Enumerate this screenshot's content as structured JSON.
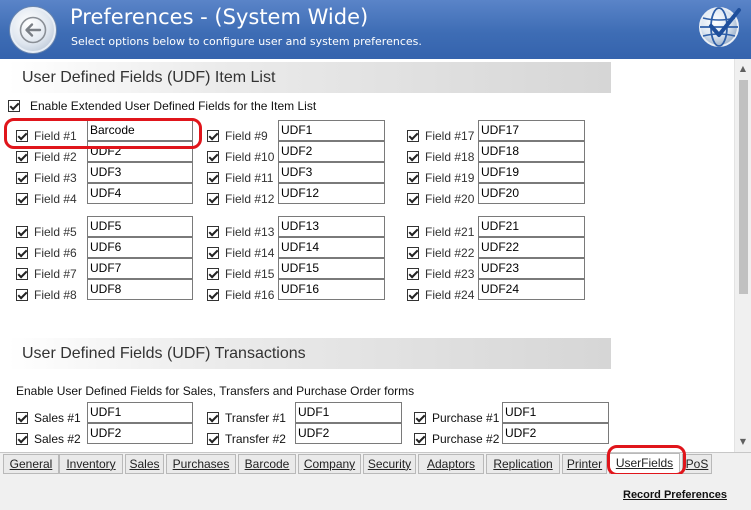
{
  "header": {
    "title": "Preferences - (System Wide)",
    "subtitle": "Select options below to configure user and system preferences."
  },
  "udf_items": {
    "section_title": "User Defined Fields (UDF) Item List",
    "enable_label": "Enable Extended User Defined Fields for the Item List",
    "enable_checked": true,
    "fields": [
      {
        "label": "Field #1",
        "value": "Barcode",
        "checked": true
      },
      {
        "label": "Field #2",
        "value": "UDF2",
        "checked": true
      },
      {
        "label": "Field #3",
        "value": "UDF3",
        "checked": true
      },
      {
        "label": "Field #4",
        "value": "UDF4",
        "checked": true
      },
      {
        "label": "Field #5",
        "value": "UDF5",
        "checked": true
      },
      {
        "label": "Field #6",
        "value": "UDF6",
        "checked": true
      },
      {
        "label": "Field #7",
        "value": "UDF7",
        "checked": true
      },
      {
        "label": "Field #8",
        "value": "UDF8",
        "checked": true
      },
      {
        "label": "Field #9",
        "value": "UDF1",
        "checked": true
      },
      {
        "label": "Field #10",
        "value": "UDF2",
        "checked": true
      },
      {
        "label": "Field #11",
        "value": "UDF3",
        "checked": true
      },
      {
        "label": "Field #12",
        "value": "UDF12",
        "checked": true
      },
      {
        "label": "Field #13",
        "value": "UDF13",
        "checked": true
      },
      {
        "label": "Field #14",
        "value": "UDF14",
        "checked": true
      },
      {
        "label": "Field #15",
        "value": "UDF15",
        "checked": true
      },
      {
        "label": "Field #16",
        "value": "UDF16",
        "checked": true
      },
      {
        "label": "Field #17",
        "value": "UDF17",
        "checked": true
      },
      {
        "label": "Field #18",
        "value": "UDF18",
        "checked": true
      },
      {
        "label": "Field #19",
        "value": "UDF19",
        "checked": true
      },
      {
        "label": "Field #20",
        "value": "UDF20",
        "checked": true
      },
      {
        "label": "Field #21",
        "value": "UDF21",
        "checked": true
      },
      {
        "label": "Field #22",
        "value": "UDF22",
        "checked": true
      },
      {
        "label": "Field #23",
        "value": "UDF23",
        "checked": true
      },
      {
        "label": "Field #24",
        "value": "UDF24",
        "checked": true
      }
    ]
  },
  "udf_transactions": {
    "section_title": "User Defined Fields (UDF) Transactions",
    "description": "Enable User Defined Fields for Sales, Transfers and Purchase Order forms",
    "sales": [
      {
        "label": "Sales #1",
        "value": "UDF1",
        "checked": true
      },
      {
        "label": "Sales #2",
        "value": "UDF2",
        "checked": true
      }
    ],
    "transfer": [
      {
        "label": "Transfer #1",
        "value": "UDF1",
        "checked": true
      },
      {
        "label": "Transfer #2",
        "value": "UDF2",
        "checked": true
      }
    ],
    "purchase": [
      {
        "label": "Purchase #1",
        "value": "UDF1",
        "checked": true
      },
      {
        "label": "Purchase #2",
        "value": "UDF2",
        "checked": true
      }
    ]
  },
  "tabs": [
    "General",
    "Inventory",
    "Sales",
    "Purchases",
    "Barcode",
    "Company",
    "Security",
    "Adaptors",
    "Replication",
    "Printer",
    "UserFields",
    "PoS"
  ],
  "active_tab": "UserFields",
  "footer": {
    "record_label": "Record Preferences"
  },
  "colors": {
    "header": "#3e6db5",
    "highlight": "#e0151b"
  }
}
